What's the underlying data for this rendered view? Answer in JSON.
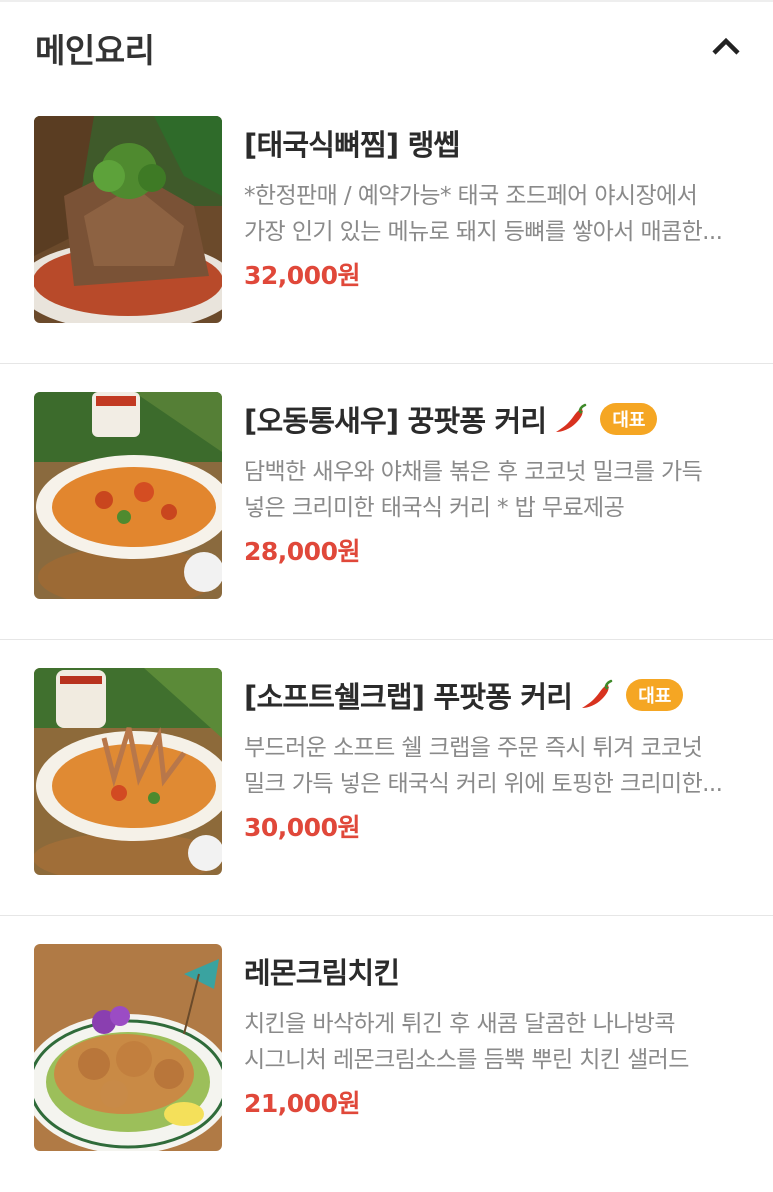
{
  "section": {
    "title": "메인요리",
    "collapse_icon": "chevron-up-icon"
  },
  "items": [
    {
      "name": "[태국식뼈찜] 랭쎕",
      "description": "*한정판매 / 예약가능* 태국 조드페어 야시장에서 가장 인기 있는 메뉴로 돼지 등뼈를 쌓아서 매콤한...",
      "price": "32,000원",
      "spicy": false,
      "badge": ""
    },
    {
      "name": "[오동통새우] 꿍팟퐁 커리",
      "description": "담백한 새우와 야채를 볶은 후 코코넛 밀크를 가득 넣은 크리미한 태국식 커리 * 밥 무료제공",
      "price": "28,000원",
      "spicy": true,
      "badge": "대표"
    },
    {
      "name": "[소프트쉘크랩] 푸팟퐁 커리",
      "description": "부드러운 소프트 쉘 크랩을 주문 즉시 튀겨 코코넛 밀크 가득 넣은 태국식 커리 위에 토핑한 크리미한...",
      "price": "30,000원",
      "spicy": true,
      "badge": "대표"
    },
    {
      "name": "레몬크림치킨",
      "description": "치킨을 바삭하게 튀긴 후 새콤 달콤한 나나방콕 시그니처 레몬크림소스를 듬뿍 뿌린 치킨 샐러드",
      "price": "21,000원",
      "spicy": false,
      "badge": ""
    }
  ],
  "colors": {
    "price": "#e0483a",
    "badge_bg": "#f5a623",
    "desc": "#8a8a8a",
    "title": "#2b2b2b"
  }
}
